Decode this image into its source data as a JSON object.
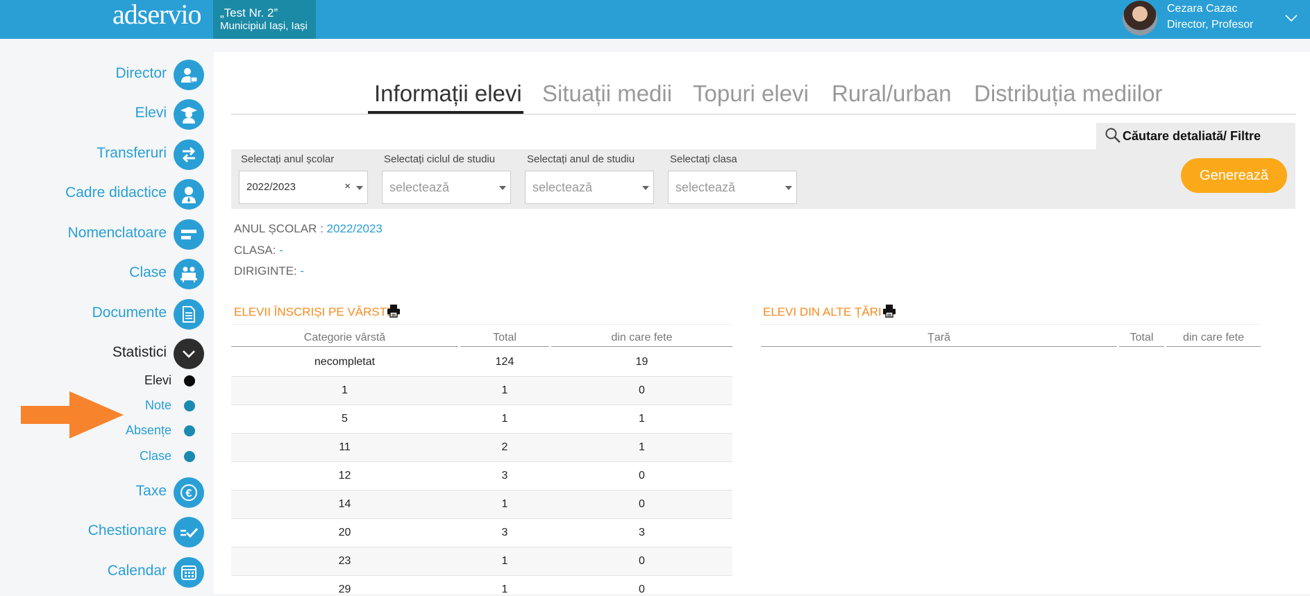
{
  "header": {
    "logo": "adservio",
    "school_name": "„Test Nr. 2”",
    "school_location": "Municipiul Iași, Iași",
    "user_name": "Cezara Cazac",
    "user_role": "Director, Profesor",
    "menu_icon": "chevron-down-icon"
  },
  "sidebar": {
    "items": [
      {
        "label": "Director",
        "icon": "director-icon"
      },
      {
        "label": "Elevi",
        "icon": "graduate-icon"
      },
      {
        "label": "Transferuri",
        "icon": "transfer-icon"
      },
      {
        "label": "Cadre didactice",
        "icon": "teacher-icon"
      },
      {
        "label": "Nomenclatoare",
        "icon": "list-icon"
      },
      {
        "label": "Clase",
        "icon": "classroom-icon"
      },
      {
        "label": "Documente",
        "icon": "document-icon"
      },
      {
        "label": "Statistici",
        "icon": "chevron-down-icon",
        "active": true
      },
      {
        "label": "Taxe",
        "icon": "euro-icon"
      },
      {
        "label": "Chestionare",
        "icon": "checklist-icon"
      },
      {
        "label": "Calendar",
        "icon": "calendar-icon"
      }
    ],
    "subitems": [
      {
        "label": "Elevi",
        "active": true
      },
      {
        "label": "Note"
      },
      {
        "label": "Absențe"
      },
      {
        "label": "Clase"
      }
    ]
  },
  "tabs": [
    {
      "label": "Informații elevi",
      "active": true
    },
    {
      "label": "Situații medii"
    },
    {
      "label": "Topuri elevi"
    },
    {
      "label": "Rural/urban"
    },
    {
      "label": "Distribuția mediilor"
    }
  ],
  "filters": {
    "header": "Căutare detaliată/ Filtre",
    "school_year_label": "Selectați anul școlar",
    "school_year_value": "2022/2023",
    "study_cycle_label": "Selectați ciclul de studiu",
    "study_year_label": "Selectați anul de studiu",
    "class_label": "Selectați clasa",
    "placeholder": "selectează",
    "clear_symbol": "×",
    "generate_button": "Generează"
  },
  "info": {
    "school_year_label": "ANUL ȘCOLAR :",
    "school_year_value": "2022/2023",
    "class_label": "CLASA:",
    "class_value": "-",
    "head_teacher_label": "DIRIGINTE:",
    "head_teacher_value": "-"
  },
  "age_table": {
    "title": "ELEVII ÎNSCRIȘI PE VÂRSTE",
    "columns": [
      "Categorie vârstă",
      "Total",
      "din care fete"
    ],
    "rows": [
      [
        "necompletat",
        "124",
        "19"
      ],
      [
        "1",
        "1",
        "0"
      ],
      [
        "5",
        "1",
        "1"
      ],
      [
        "11",
        "2",
        "1"
      ],
      [
        "12",
        "3",
        "0"
      ],
      [
        "14",
        "1",
        "0"
      ],
      [
        "20",
        "3",
        "3"
      ],
      [
        "23",
        "1",
        "0"
      ],
      [
        "29",
        "1",
        "0"
      ]
    ]
  },
  "foreign_table": {
    "title": "ELEVI DIN ALTE ȚĂRI",
    "columns": [
      "Țară",
      "Total",
      "din care fete"
    ]
  },
  "colors": {
    "primary": "#2a9fd6",
    "school_box": "#1b8aa6",
    "accent_orange": "#f58b1f",
    "button_orange": "#fba919",
    "active_dark": "#2d2d2d"
  }
}
